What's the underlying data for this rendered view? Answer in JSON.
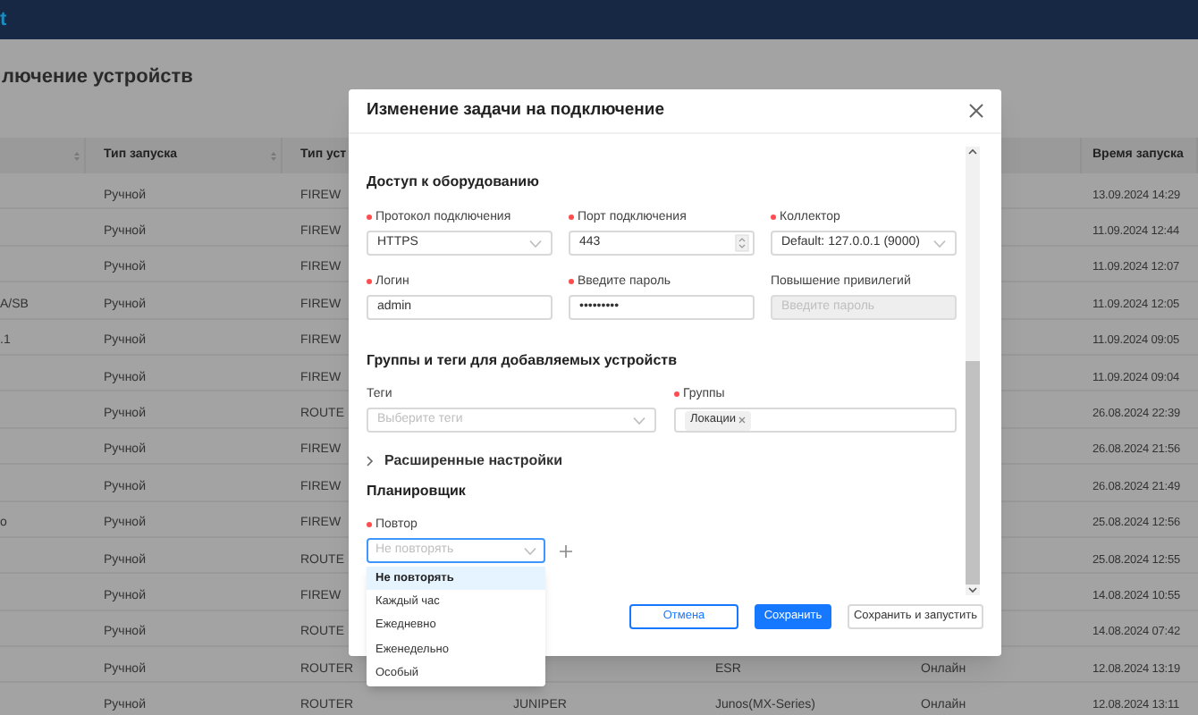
{
  "app_bar": {
    "logo_text": "t"
  },
  "page_title": "лючение устройств",
  "table": {
    "columns": [
      {
        "sortable": true
      },
      {
        "label": "Тип запуска",
        "sortable": true
      },
      {
        "label": "Тип уст"
      },
      {},
      {},
      {},
      {
        "label": "Время запуска",
        "sortable": false
      }
    ],
    "rows": [
      {
        "cells": [
          null,
          "Ручной",
          "FIREW",
          null,
          null,
          null,
          "13.09.2024 14:29"
        ]
      },
      {
        "cells": [
          null,
          "Ручной",
          "FIREW",
          null,
          null,
          null,
          "11.09.2024 12:44"
        ]
      },
      {
        "cells": [
          null,
          "Ручной",
          "FIREW",
          null,
          null,
          null,
          "11.09.2024 12:07"
        ]
      },
      {
        "cells": [
          "A/SB",
          "Ручной",
          "FIREW",
          null,
          null,
          null,
          "11.09.2024 12:05"
        ]
      },
      {
        "cells": [
          ".1",
          "Ручной",
          "FIREW",
          null,
          null,
          null,
          "11.09.2024 09:05"
        ]
      },
      {
        "cells": [
          null,
          "Ручной",
          "FIREW",
          null,
          null,
          null,
          "11.09.2024 09:04"
        ]
      },
      {
        "cells": [
          null,
          "Ручной",
          "ROUTE",
          null,
          null,
          null,
          "26.08.2024 22:39"
        ]
      },
      {
        "cells": [
          null,
          "Ручной",
          "FIREW",
          null,
          null,
          null,
          "26.08.2024 21:56"
        ]
      },
      {
        "cells": [
          null,
          "Ручной",
          "FIREW",
          null,
          null,
          null,
          "26.08.2024 21:49"
        ]
      },
      {
        "cells": [
          "o",
          "Ручной",
          "FIREW",
          null,
          null,
          null,
          "25.08.2024 12:56"
        ]
      },
      {
        "cells": [
          null,
          "Ручной",
          "ROUTE",
          null,
          null,
          null,
          "25.08.2024 12:55"
        ]
      },
      {
        "cells": [
          null,
          "Ручной",
          "FIREW",
          null,
          null,
          null,
          "14.08.2024 10:55"
        ]
      },
      {
        "cells": [
          null,
          "Ручной",
          "ROUTE",
          null,
          null,
          null,
          "14.08.2024 07:42"
        ]
      },
      {
        "cells": [
          null,
          "Ручной",
          "ROUTER",
          null,
          "ESR",
          "Онлайн",
          "12.08.2024 13:19"
        ]
      },
      {
        "cells": [
          null,
          "Ручной",
          "ROUTER",
          "JUNIPER",
          "Junos(MX-Series)",
          "Онлайн",
          "12.08.2024 13:11"
        ]
      }
    ]
  },
  "dialog": {
    "title": "Изменение задачи на подключение",
    "access": {
      "title": "Доступ к оборудованию",
      "fields": [
        {
          "label": "Протокол подключения",
          "required": true,
          "kind": "select",
          "value": "HTTPS",
          "disabled": false
        },
        {
          "label": "Порт подключения",
          "required": true,
          "kind": "number",
          "value": "443",
          "disabled": false
        },
        {
          "label": "Коллектор",
          "required": true,
          "kind": "select",
          "value": "Default: 127.0.0.1 (9000)",
          "disabled": false
        },
        {
          "label": "Логин",
          "required": true,
          "kind": "text",
          "value": "admin",
          "disabled": false
        },
        {
          "label": "Введите пароль",
          "required": true,
          "kind": "text",
          "value": "•••••••••",
          "disabled": false
        },
        {
          "label": "Повышение привилегий",
          "required": false,
          "kind": "text",
          "placeholder": "Введите пароль",
          "disabled": true
        }
      ]
    },
    "groups": {
      "title": "Группы и теги для добавляемых устройств",
      "fields": [
        {
          "label": "Теги",
          "required": false,
          "kind": "select",
          "placeholder": "Выберите теги"
        },
        {
          "label": "Группы",
          "required": true,
          "kind": "tags",
          "tags": [
            "Локации"
          ]
        }
      ]
    },
    "advanced": {
      "label": "Расширенные настройки",
      "expanded": false
    },
    "scheduler": {
      "title": "Планировщик",
      "repeat": {
        "label": "Повтор",
        "required": true,
        "placeholder": "Не повторять",
        "open": true,
        "options": [
          {
            "label": "Не повторять",
            "selected": true
          },
          {
            "label": "Каждый час",
            "selected": false
          },
          {
            "label": "Ежедневно",
            "selected": false
          },
          {
            "label": "Еженедельно",
            "selected": false
          },
          {
            "label": "Особый",
            "selected": false
          }
        ]
      }
    },
    "buttons": [
      {
        "label": "Отмена",
        "kind": "outline"
      },
      {
        "label": "Сохранить",
        "kind": "primary"
      },
      {
        "label": "Сохранить и запустить",
        "kind": "default"
      }
    ]
  }
}
